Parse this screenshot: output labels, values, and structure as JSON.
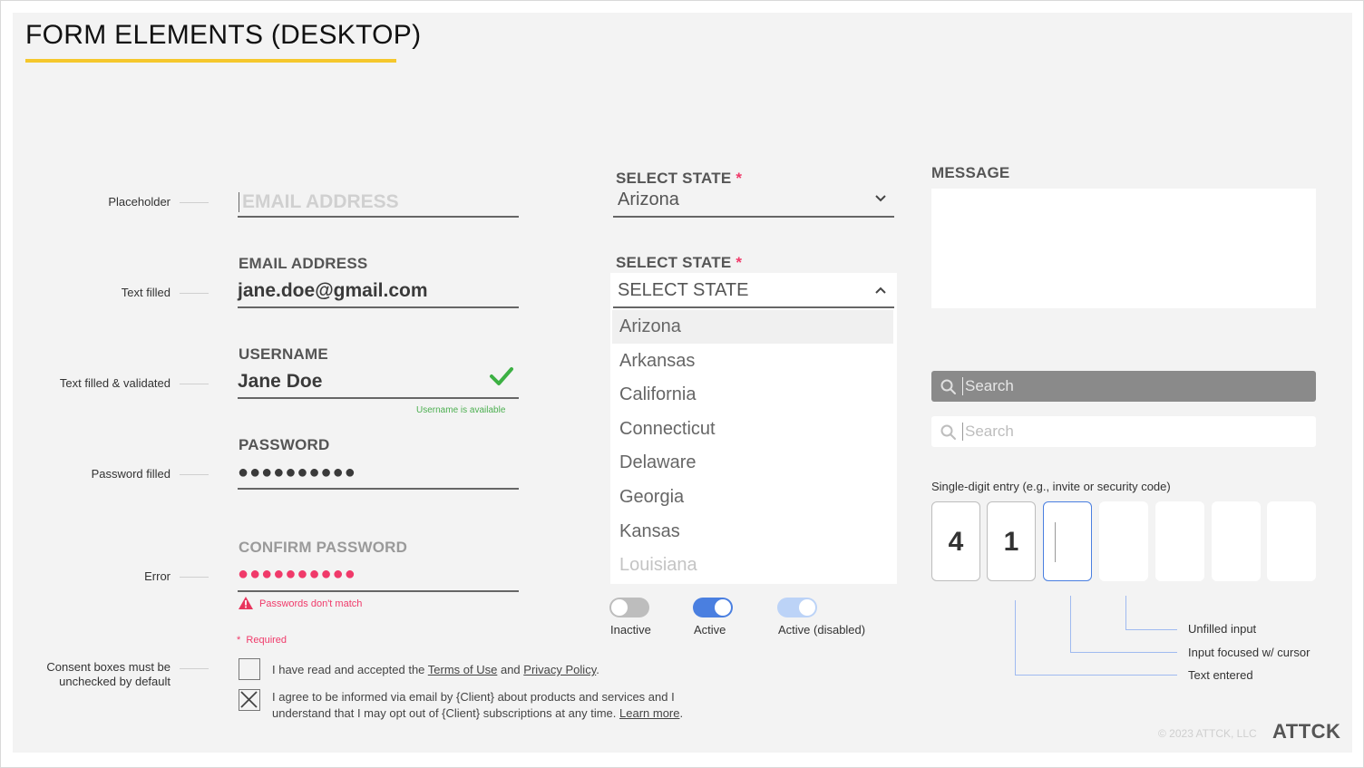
{
  "title": "FORM ELEMENTS (DESKTOP)",
  "annotations": {
    "placeholder": "Placeholder",
    "text_filled": "Text filled",
    "text_validated": "Text filled & validated",
    "password_filled": "Password filled",
    "error": "Error",
    "consent_line1": "Consent boxes must be",
    "consent_line2": "unchecked by default"
  },
  "fields": {
    "email_placeholder": "EMAIL ADDRESS",
    "email_label": "EMAIL ADDRESS",
    "email_value": "jane.doe@gmail.com",
    "username_label": "USERNAME",
    "username_value": "Jane Doe",
    "username_hint": "Username is available",
    "password_label": "PASSWORD",
    "password_value": "●●●●●●●●●●",
    "confirm_label": "CONFIRM PASSWORD",
    "confirm_value": "●●●●●●●●●●",
    "confirm_error": "Passwords don't match",
    "required_mark": "*",
    "required_text": "Required"
  },
  "consent": {
    "box1_pre": "I have read and accepted the ",
    "terms_link": "Terms of Use",
    "box1_mid": " and ",
    "privacy_link": "Privacy Policy",
    "box1_post": ".",
    "box2_line1": "I agree to be informed via email by {Client} about products and services and I",
    "box2_line2": "understand that I may opt out of {Client} subscriptions at any time. ",
    "learn_more": "Learn more",
    "box2_post": "."
  },
  "selects": {
    "label": "SELECT STATE",
    "required_mark": "*",
    "closed_value": "Arizona",
    "open_placeholder": "SELECT STATE",
    "options": [
      "Arizona",
      "Arkansas",
      "California",
      "Connecticut",
      "Delaware",
      "Georgia",
      "Kansas",
      "Louisiana"
    ]
  },
  "toggles": {
    "inactive": "Inactive",
    "active": "Active",
    "disabled": "Active (disabled)",
    "color_active": "#4a7fe0",
    "color_disabled": "#bcd3f7",
    "color_inactive": "#bdbdbd"
  },
  "message": {
    "label": "MESSAGE"
  },
  "search": {
    "placeholder": "Search"
  },
  "digits": {
    "caption": "Single-digit entry (e.g., invite or security code)",
    "values": [
      "4",
      "1",
      "",
      "",
      "",
      "",
      ""
    ],
    "legend_unfilled": "Unfilled input",
    "legend_focused": "Input focused w/ cursor",
    "legend_entered": "Text entered"
  },
  "footer": {
    "copyright": "© 2023 ATTCK, LLC",
    "logo": "ATTCK"
  }
}
